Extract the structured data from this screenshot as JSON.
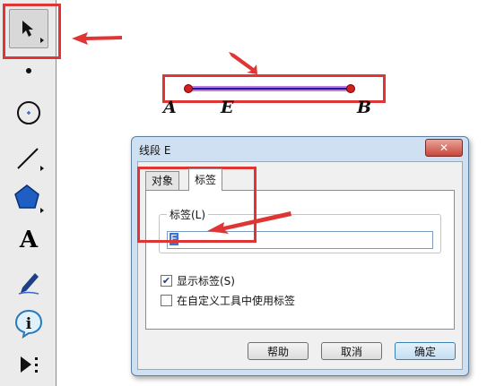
{
  "canvas": {
    "points": [
      "A",
      "E",
      "B"
    ],
    "colors": {
      "segment": "#1a1aa0",
      "segment_highlight": "#c07cd6",
      "point": "#d02020",
      "annotation": "#e03535"
    }
  },
  "toolbar": {
    "tools": [
      "arrow-tool-icon",
      "point-tool-icon",
      "compass-tool-icon",
      "segment-tool-icon",
      "polygon-tool-icon",
      "text-tool-icon",
      "marker-tool-icon",
      "info-tool-icon",
      "custom-tool-icon"
    ],
    "text_tool_glyph": "A",
    "info_glyph": "i"
  },
  "dialog": {
    "title": "线段 E",
    "close_glyph": "✕",
    "tabs": [
      "对象",
      "标签"
    ],
    "active_tab": "标签",
    "label_group_title": "标签(L)",
    "label_value": "E",
    "checkbox_show_label": {
      "text": "显示标签(S)",
      "checked": true,
      "mark": "✔"
    },
    "checkbox_custom_tool": {
      "text": "在自定义工具中使用标签",
      "checked": false
    },
    "buttons": {
      "help": "帮助",
      "cancel": "取消",
      "ok": "确定"
    }
  }
}
